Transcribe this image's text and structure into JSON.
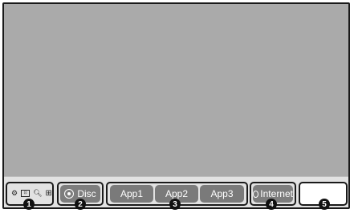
{
  "home_menu": {
    "settings_icons": [
      "gear-icon",
      "input-icon",
      "search-icon",
      "grid-icon"
    ],
    "disc_label": "Disc",
    "apps": [
      "App1",
      "App2",
      "App3"
    ],
    "internet_label": "Internet",
    "callouts": [
      "1",
      "2",
      "3",
      "4",
      "5"
    ]
  }
}
